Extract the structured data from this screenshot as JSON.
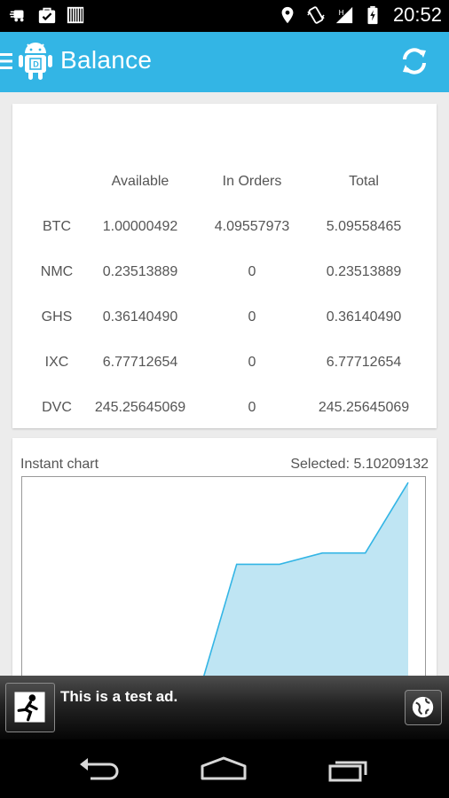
{
  "status_bar": {
    "time": "20:52"
  },
  "action_bar": {
    "title": "Balance"
  },
  "balance_table": {
    "headers": [
      "",
      "Available",
      "In Orders",
      "Total"
    ],
    "rows": [
      [
        "BTC",
        "1.00000492",
        "4.09557973",
        "5.09558465"
      ],
      [
        "NMC",
        "0.23513889",
        "0",
        "0.23513889"
      ],
      [
        "GHS",
        "0.36140490",
        "0",
        "0.36140490"
      ],
      [
        "IXC",
        "6.77712654",
        "0",
        "6.77712654"
      ],
      [
        "DVC",
        "245.25645069",
        "0",
        "245.25645069"
      ]
    ]
  },
  "chart": {
    "title": "Instant chart",
    "selected_label": "Selected: 5.10209132"
  },
  "chart_data": {
    "type": "area",
    "title": "Instant chart",
    "x": [
      0,
      1,
      2,
      3,
      4,
      5,
      6,
      7,
      8,
      9
    ],
    "values": [
      1.0,
      1.0,
      1.0,
      1.0,
      1.05,
      3.65,
      3.65,
      3.85,
      3.85,
      5.10209132
    ],
    "ylim": [
      0,
      5.2
    ],
    "grid": false,
    "color": "#33b5e5",
    "fill": "#bfe5f3"
  },
  "ad": {
    "text": "This is a test ad."
  },
  "colors": {
    "accent": "#33b5e5",
    "background": "#ececec",
    "card": "#ffffff"
  }
}
